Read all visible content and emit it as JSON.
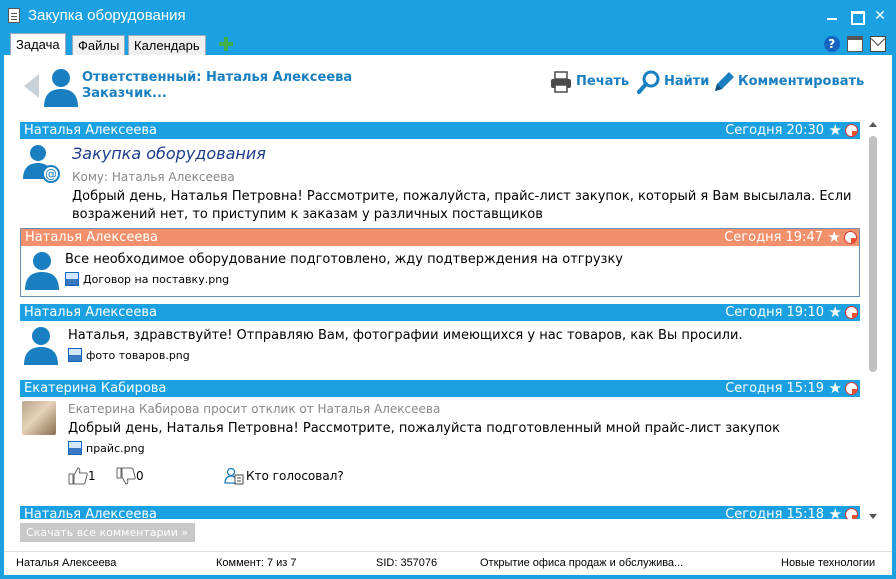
{
  "window": {
    "title": "Закупка оборудования"
  },
  "tabs": [
    {
      "label": "Задача"
    },
    {
      "label": "Файлы"
    },
    {
      "label": "Календарь"
    }
  ],
  "header": {
    "responsible": "Ответственный: Наталья Алексеева",
    "customer": "Заказчик...",
    "print_label": "Печать",
    "find_label": "Найти",
    "comment_label": "Комментировать"
  },
  "comments": [
    {
      "author": "Наталья Алексеева",
      "time": "Сегодня 20:30",
      "title": "Закупка оборудования",
      "to": "Кому: Наталья Алексеева",
      "text_line1": "Добрый день, Наталья Петровна! Рассмотрите, пожалуйста, прайс-лист закупок, который я Вам высылала. Если",
      "text_line2": "возражений нет, то приступим к заказам у различных поставщиков"
    },
    {
      "author": "Наталья Алексеева",
      "time": "Сегодня 19:47",
      "text": "Все необходимое оборудование подготовлено, жду подтверждения на отгрузку",
      "attachment": "Договор на поставку.png"
    },
    {
      "author": "Наталья Алексеева",
      "time": "Сегодня 19:10",
      "text": "Наталья, здравствуйте! Отправляю Вам, фотографии имеющихся у нас товаров, как Вы просили.",
      "attachment": "фото товаров.png"
    },
    {
      "author": "Екатерина Кабирова",
      "time": "Сегодня 15:19",
      "sub": "Екатерина Кабирова просит отклик от Наталья Алексеева",
      "text": "Добрый день, Наталья Петровна! Рассмотрите, пожалуйста подготовленный мной прайс-лист закупок",
      "attachment": "прайс.png",
      "likes": "1",
      "dislikes": "0",
      "who_voted": "Кто голосовал?"
    },
    {
      "author": "Наталья Алексеева",
      "time": "Сегодня 15:18"
    }
  ],
  "download_all": "Скачать все комментарии »",
  "status": {
    "user": "Наталья Алексеева",
    "comment_count": "Коммент: 7 из 7",
    "sid": "SID: 357076",
    "task": "Открытие офиса продаж и обслужива...",
    "company": "Новые технологии"
  },
  "colors": {
    "accent": "#1ba1e2",
    "highlight": "#f3906c",
    "link": "#1a7fc0"
  }
}
